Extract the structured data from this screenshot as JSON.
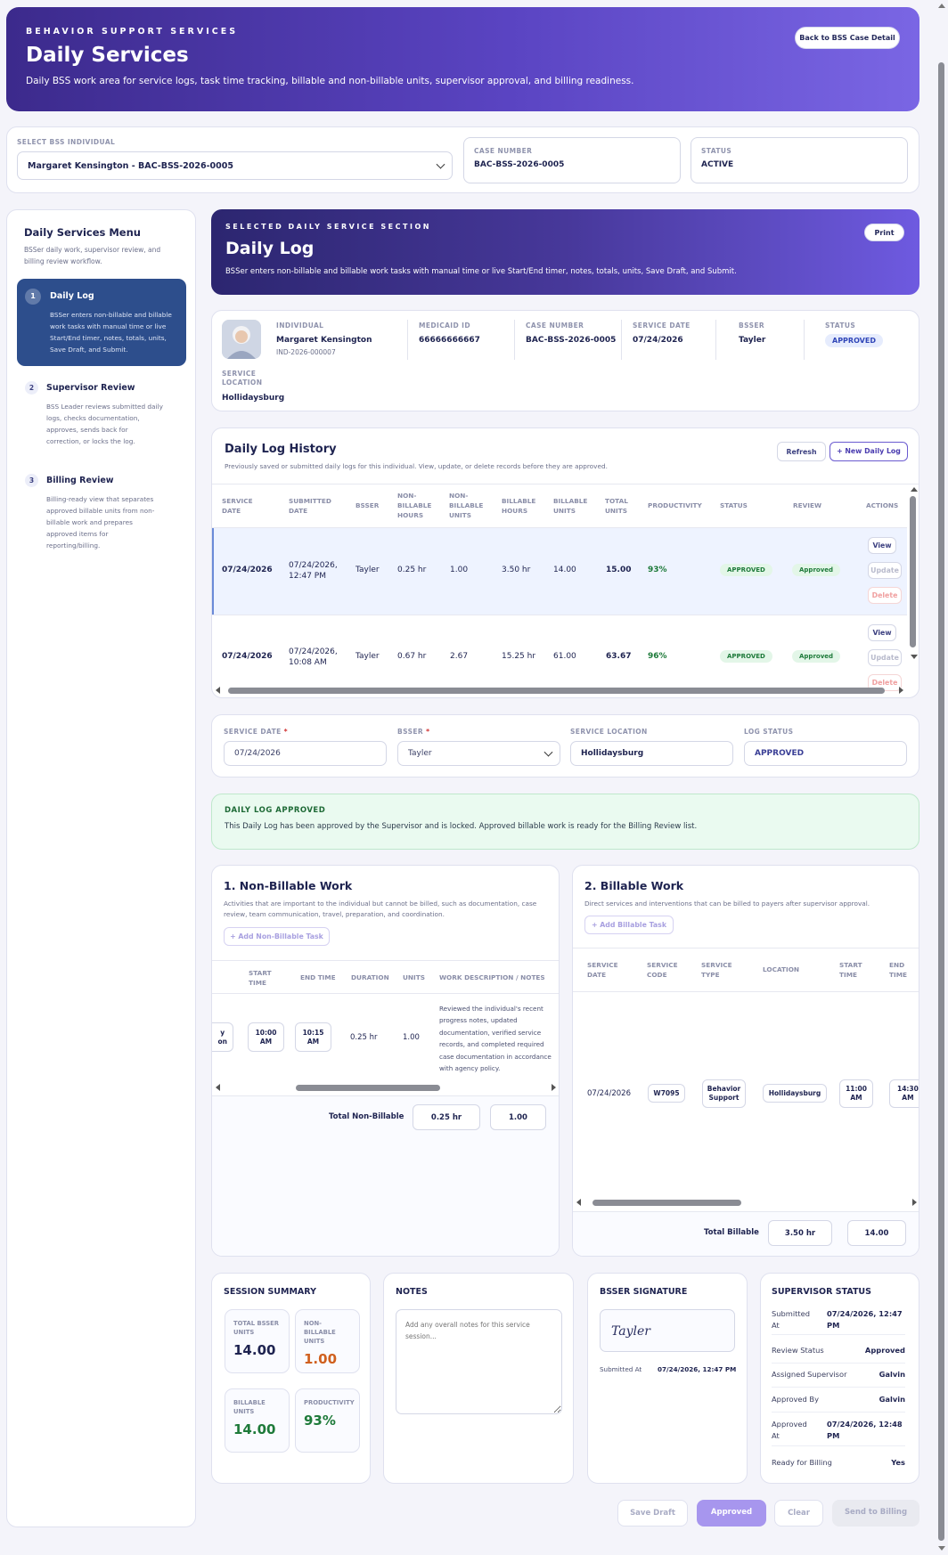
{
  "header": {
    "eyebrow": "BEHAVIOR SUPPORT SERVICES",
    "title": "Daily Services",
    "subtitle": "Daily BSS work area for service logs, task time tracking, billable and non-billable units, supervisor approval, and billing readiness.",
    "back_button": "Back to BSS Case Detail"
  },
  "selector": {
    "label": "SELECT BSS INDIVIDUAL",
    "value": "Margaret Kensington - BAC-BSS-2026-0005",
    "case_label": "CASE NUMBER",
    "case_value": "BAC-BSS-2026-0005",
    "status_label": "STATUS",
    "status_value": "ACTIVE"
  },
  "menu": {
    "title": "Daily Services Menu",
    "subtitle": "BSSer daily work, supervisor review, and billing review workflow.",
    "items": [
      {
        "num": "1",
        "title": "Daily Log",
        "desc": "BSSer enters non-billable and billable work tasks with manual time or live Start/End timer, notes, totals, units, Save Draft, and Submit."
      },
      {
        "num": "2",
        "title": "Supervisor Review",
        "desc": "BSS Leader reviews submitted daily logs, checks documentation, approves, sends back for correction, or locks the log."
      },
      {
        "num": "3",
        "title": "Billing Review",
        "desc": "Billing-ready view that separates approved billable units from non-billable work and prepares approved items for reporting/billing."
      }
    ]
  },
  "section": {
    "eyebrow": "SELECTED DAILY SERVICE SECTION",
    "title": "Daily Log",
    "subtitle": "BSSer enters non-billable and billable work tasks with manual time or live Start/End timer, notes, totals, units, Save Draft, and Submit.",
    "print": "Print"
  },
  "individual": {
    "individual_label": "INDIVIDUAL",
    "name": "Margaret Kensington",
    "id": "IND-2026-000007",
    "medicaid_label": "MEDICAID ID",
    "medicaid": "66666666667",
    "case_label": "CASE NUMBER",
    "case": "BAC-BSS-2026-0005",
    "date_label": "SERVICE DATE",
    "date": "07/24/2026",
    "bsser_label": "BSSER",
    "bsser": "Tayler",
    "status_label": "STATUS",
    "status": "APPROVED",
    "location_label": "SERVICE LOCATION",
    "location": "Hollidaysburg"
  },
  "history": {
    "title": "Daily Log History",
    "subtitle": "Previously saved or submitted daily logs for this individual. View, update, or delete records before they are approved.",
    "refresh": "Refresh",
    "new": "+ New Daily Log",
    "columns": [
      "SERVICE DATE",
      "SUBMITTED DATE",
      "BSSER",
      "NON-BILLABLE HOURS",
      "NON-BILLABLE UNITS",
      "BILLABLE HOURS",
      "BILLABLE UNITS",
      "TOTAL UNITS",
      "PRODUCTIVITY",
      "STATUS",
      "REVIEW",
      "ACTIONS"
    ],
    "rows": [
      {
        "date": "07/24/2026",
        "submitted": "07/24/2026, 12:47 PM",
        "bsser": "Tayler",
        "nb_hours": "0.25 hr",
        "nb_units": "1.00",
        "b_hours": "3.50 hr",
        "b_units": "14.00",
        "total": "15.00",
        "prod": "93%",
        "status": "APPROVED",
        "review": "Approved",
        "view": "View",
        "update": "Update",
        "delete": "Delete"
      },
      {
        "date": "07/24/2026",
        "submitted": "07/24/2026, 10:08 AM",
        "bsser": "Tayler",
        "nb_hours": "0.67 hr",
        "nb_units": "2.67",
        "b_hours": "15.25 hr",
        "b_units": "61.00",
        "total": "63.67",
        "prod": "96%",
        "status": "APPROVED",
        "review": "Approved",
        "view": "View",
        "update": "Update",
        "delete": "Delete"
      }
    ]
  },
  "form": {
    "date_label": "SERVICE DATE",
    "date": "07/24/2026",
    "bsser_label": "BSSER",
    "bsser": "Tayler",
    "location_label": "SERVICE LOCATION",
    "location": "Hollidaysburg",
    "status_label": "LOG STATUS",
    "status": "APPROVED",
    "required": "*"
  },
  "approved_banner": {
    "title": "DAILY LOG APPROVED",
    "text": "This Daily Log has been approved by the Supervisor and is locked. Approved billable work is ready for the Billing Review list."
  },
  "nonbillable": {
    "title": "1. Non-Billable Work",
    "desc": "Activities that are important to the individual but cannot be billed, such as documentation, case review, team communication, travel, preparation, and coordination.",
    "add": "+ Add Non-Billable Task",
    "columns": [
      "START TIME",
      "END TIME",
      "DURATION",
      "UNITS",
      "WORK DESCRIPTION / NOTES"
    ],
    "row": {
      "partial": "y\non",
      "start": "10:00\nAM",
      "end": "10:15\nAM",
      "duration": "0.25 hr",
      "units": "1.00",
      "notes": "Reviewed the individual's recent progress notes, updated documentation, verified service records, and completed required case documentation in accordance with agency policy."
    },
    "total_label": "Total Non-Billable",
    "total_hours": "0.25 hr",
    "total_units": "1.00"
  },
  "billable": {
    "title": "2. Billable Work",
    "desc": "Direct services and interventions that can be billed to payers after supervisor approval.",
    "add": "+ Add Billable Task",
    "columns": [
      "SERVICE DATE",
      "SERVICE CODE",
      "SERVICE TYPE",
      "LOCATION",
      "START TIME",
      "END TIME"
    ],
    "row": {
      "date": "07/24/2026",
      "code": "W7095",
      "type": "Behavior\nSupport",
      "location": "Hollidaysburg",
      "start": "11:00\nAM",
      "end": "14:30\nAM"
    },
    "total_label": "Total Billable",
    "total_hours": "3.50 hr",
    "total_units": "14.00"
  },
  "summary": {
    "title": "SESSION SUMMARY",
    "total_label": "TOTAL BSSER UNITS",
    "total": "14.00",
    "nb_label": "NON-BILLABLE UNITS",
    "nb": "1.00",
    "b_label": "BILLABLE UNITS",
    "b": "14.00",
    "prod_label": "PRODUCTIVITY",
    "prod": "93%"
  },
  "notes": {
    "title": "NOTES",
    "placeholder": "Add any overall notes for this service session..."
  },
  "signature": {
    "title": "BSSER SIGNATURE",
    "sig": "Tayler",
    "submitted_label": "Submitted At",
    "submitted": "07/24/2026, 12:47 PM"
  },
  "supervisor": {
    "title": "SUPERVISOR STATUS",
    "rows": [
      {
        "label": "Submitted At",
        "value": "07/24/2026, 12:47 PM"
      },
      {
        "label": "Review Status",
        "value": "Approved"
      },
      {
        "label": "Assigned Supervisor",
        "value": "Galvin"
      },
      {
        "label": "Approved By",
        "value": "Galvin"
      },
      {
        "label": "Approved At",
        "value": "07/24/2026, 12:48 PM"
      },
      {
        "label": "Ready for Billing",
        "value": "Yes"
      }
    ]
  },
  "footer": {
    "save": "Save Draft",
    "approved": "Approved",
    "clear": "Clear",
    "send": "Send to Billing"
  },
  "colors": {
    "accent": "#5a44c2",
    "green": "#1e7a3a",
    "orange": "#d0601e"
  }
}
